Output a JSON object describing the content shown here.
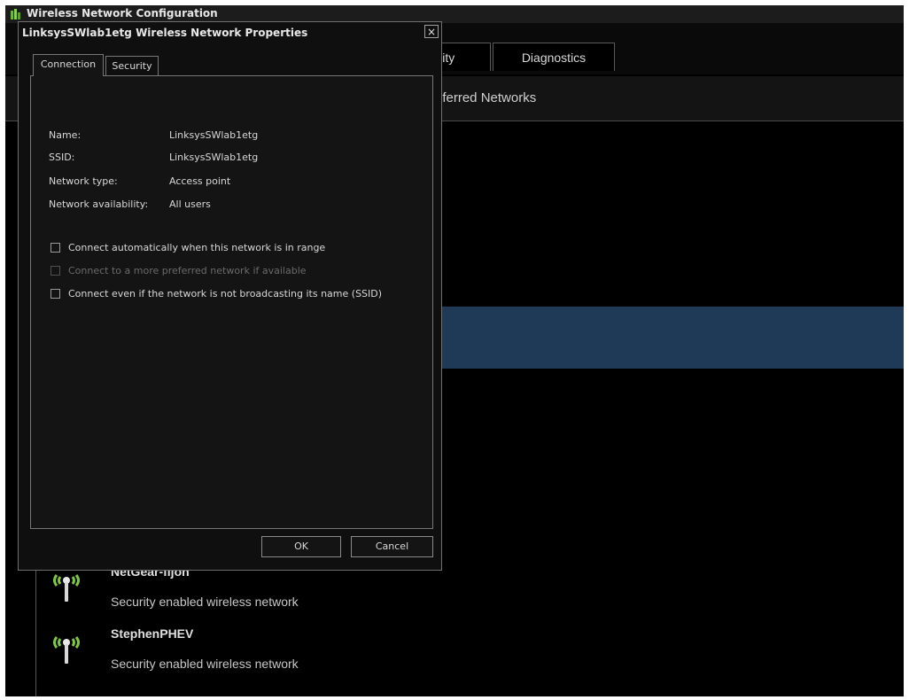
{
  "main_window": {
    "title": "Wireless Network Configuration",
    "tabs": [
      {
        "label": "urity"
      },
      {
        "label": "Diagnostics"
      }
    ],
    "section_header": "referred Networks",
    "networks": [
      {
        "name": "NetGear-fijon",
        "description": "Security enabled wireless network",
        "icon": "wireless-antenna-icon"
      },
      {
        "name": "StephenPHEV",
        "description": "Security enabled wireless network",
        "icon": "wireless-antenna-icon"
      }
    ]
  },
  "dialog": {
    "title": "LinksysSWlab1etg Wireless Network Properties",
    "close_label": "×",
    "tabs": [
      {
        "label": "Connection",
        "selected": true
      },
      {
        "label": "Security",
        "selected": false
      }
    ],
    "info": [
      {
        "label": "Name:",
        "value": "LinksysSWlab1etg"
      },
      {
        "label": "SSID:",
        "value": "LinksysSWlab1etg"
      },
      {
        "label": "Network type:",
        "value": "Access point"
      },
      {
        "label": "Network availability:",
        "value": "All users"
      }
    ],
    "options": [
      {
        "label": "Connect automatically when this network is in range",
        "checked": false,
        "enabled": true
      },
      {
        "label": "Connect to a more preferred network if available",
        "checked": false,
        "enabled": false
      },
      {
        "label": "Connect even if the network is not broadcasting its name (SSID)",
        "checked": false,
        "enabled": true
      }
    ],
    "buttons": {
      "ok": "OK",
      "cancel": "Cancel"
    }
  },
  "colors": {
    "background": "#000000",
    "selection": "#1e3a57",
    "antenna_wave": "#7fc642",
    "text": "#d8d8d8"
  }
}
